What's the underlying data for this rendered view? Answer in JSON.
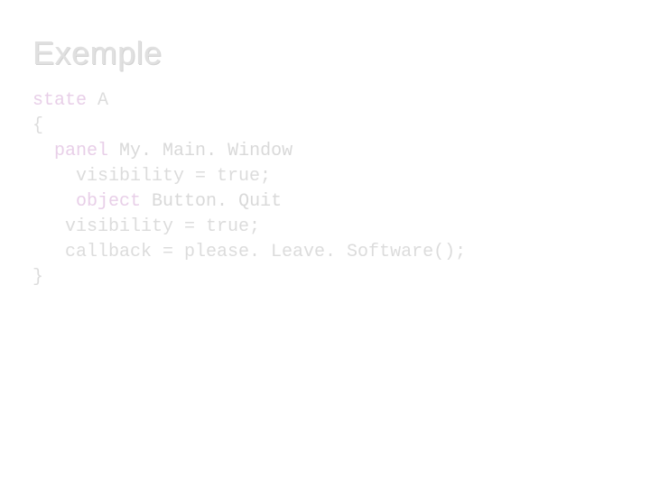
{
  "title": "Exemple",
  "code": {
    "l1_kw": "state",
    "l1_sp": " ",
    "l1_id": "A",
    "l2": "{",
    "l3_pad": "  ",
    "l3_kw": "panel",
    "l3_sp": " ",
    "l3_id": "My. Main. Window",
    "l4": "    visibility = true;",
    "l5_pad": "    ",
    "l5_kw": "object",
    "l5_sp": " ",
    "l5_id": "Button. Quit",
    "l6": "   visibility = true;",
    "l7": "   callback = please. Leave. Software();",
    "l8": "}"
  }
}
